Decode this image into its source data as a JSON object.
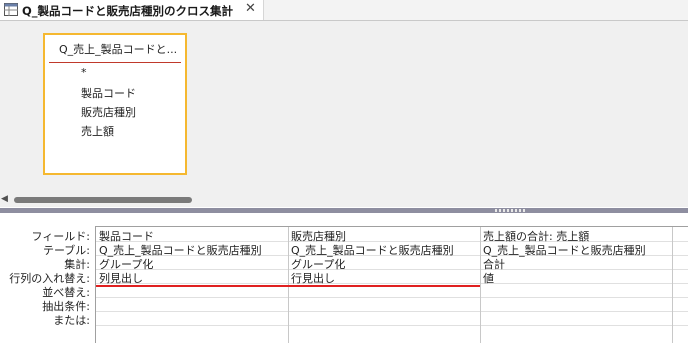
{
  "tab": {
    "title": "Q_製品コードと販売店種別のクロス集計",
    "close": "✕"
  },
  "table_box": {
    "title": "Q_売上_製品コードと...",
    "fields": [
      "*",
      "製品コード",
      "販売店種別",
      "売上額"
    ]
  },
  "grid": {
    "row_labels": [
      "フィールド:",
      "テーブル:",
      "集計:",
      "行列の入れ替え:",
      "並べ替え:",
      "抽出条件:",
      "または:"
    ],
    "columns": [
      {
        "field": "製品コード",
        "table": "Q_売上_製品コードと販売店種別",
        "total": "グループ化",
        "crosstab": "列見出し"
      },
      {
        "field": "販売店種別",
        "table": "Q_売上_製品コードと販売店種別",
        "total": "グループ化",
        "crosstab": "行見出し"
      },
      {
        "field": "売上額の合計: 売上額",
        "table": "Q_売上_製品コードと販売店種別",
        "total": "合計",
        "crosstab": "値"
      }
    ]
  },
  "colors": {
    "table_border": "#f5b830",
    "relation_line": "#c0392b",
    "highlight_line": "#e02020"
  }
}
